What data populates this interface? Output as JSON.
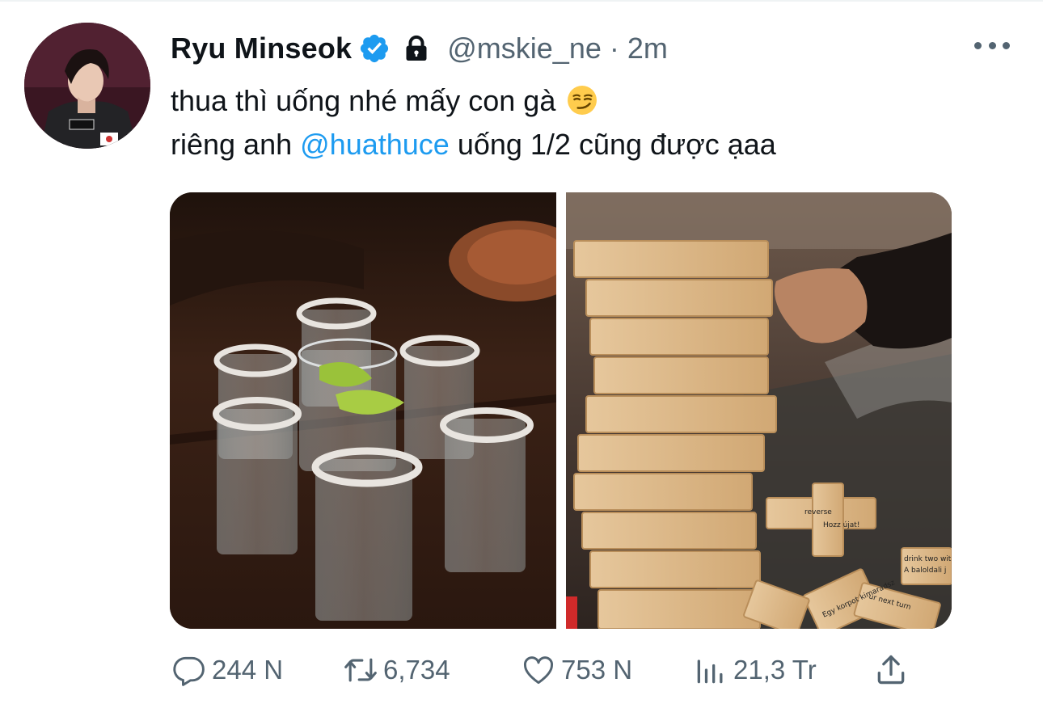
{
  "tweet": {
    "author": {
      "display_name": "Ryu Minseok",
      "handle": "@mskie_ne",
      "verified": true,
      "protected": true
    },
    "separator": "·",
    "time_ago": "2m",
    "text_line1": "thua thì uống nhé mấy con gà",
    "text_line1_emoji": "smirking-face",
    "text_line2_before": "riêng anh ",
    "text_line2_mention": "@huathuce",
    "text_line2_after": " uống 1/2 cũng được ạaa",
    "media": [
      {
        "name": "tequila-shot-glasses-photo"
      },
      {
        "name": "wooden-block-tower-game-photo",
        "block_texts": [
          "reverse",
          "Hozz újat!",
          "drink two wit",
          "A baloldali j",
          "Egy korpot kimaradsz",
          "ur next turn"
        ]
      }
    ],
    "actions": {
      "replies": "244 N",
      "retweets": "6,734",
      "likes": "753 N",
      "views": "21,3 Tr"
    }
  },
  "colors": {
    "text": "#0f1419",
    "secondary": "#536471",
    "accent": "#1d9bf0",
    "divider": "#eff3f4"
  }
}
